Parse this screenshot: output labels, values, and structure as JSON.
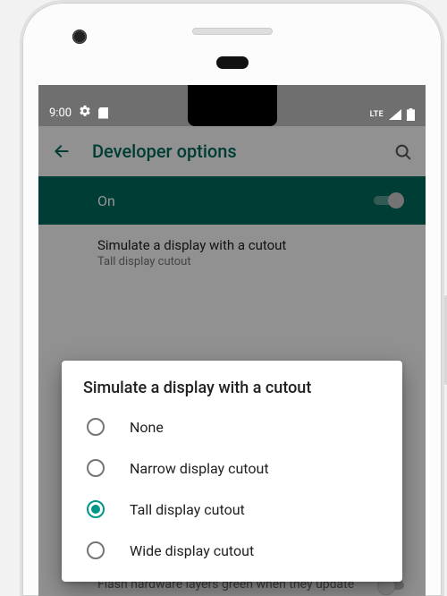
{
  "status_bar": {
    "time": "9:00",
    "network_label": "LTE"
  },
  "app_bar": {
    "title": "Developer options"
  },
  "master_toggle": {
    "label": "On",
    "state": true
  },
  "current_setting": {
    "title": "Simulate a display with a cutout",
    "subtitle": "Tall display cutout"
  },
  "background_item": {
    "text": "Flash hardware layers green when they update"
  },
  "dialog": {
    "title": "Simulate a display with a cutout",
    "selected_index": 2,
    "options": [
      {
        "label": "None"
      },
      {
        "label": "Narrow display cutout"
      },
      {
        "label": "Tall display cutout"
      },
      {
        "label": "Wide display cutout"
      }
    ]
  },
  "colors": {
    "accent": "#009688",
    "primary_dark": "#00695c"
  }
}
